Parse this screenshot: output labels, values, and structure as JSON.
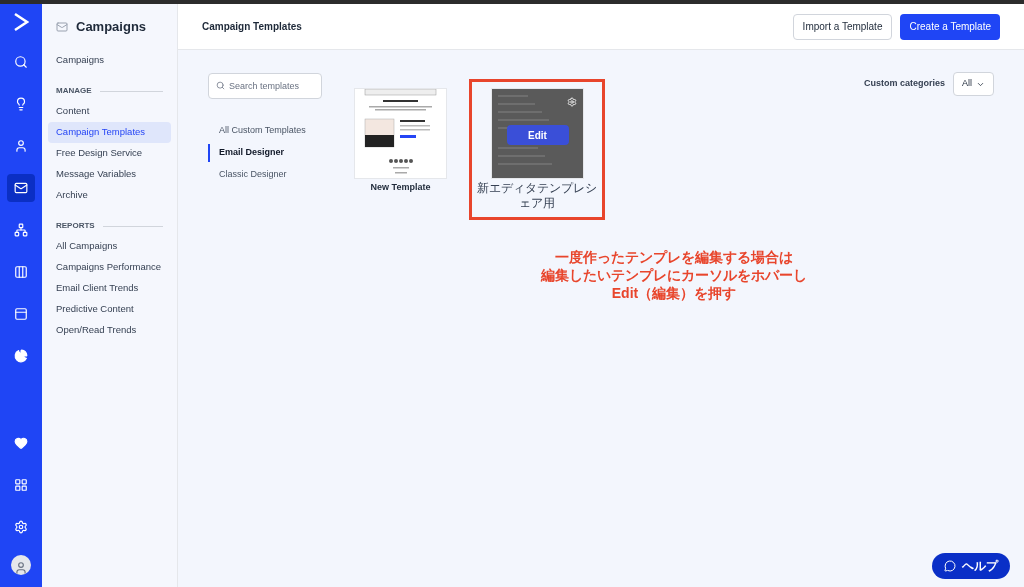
{
  "rail": {
    "items": [
      {
        "selected": false
      },
      {
        "selected": false
      },
      {
        "selected": false
      },
      {
        "selected": true
      },
      {
        "selected": false
      },
      {
        "selected": false
      },
      {
        "selected": false
      },
      {
        "selected": false
      }
    ]
  },
  "sidebar": {
    "title": "Campaigns",
    "sections": [
      {
        "items": [
          {
            "label": "Campaigns",
            "selected": false
          }
        ]
      },
      {
        "heading": "MANAGE",
        "items": [
          {
            "label": "Content",
            "selected": false
          },
          {
            "label": "Campaign Templates",
            "selected": true
          },
          {
            "label": "Free Design Service",
            "selected": false
          },
          {
            "label": "Message Variables",
            "selected": false
          },
          {
            "label": "Archive",
            "selected": false
          }
        ]
      },
      {
        "heading": "REPORTS",
        "items": [
          {
            "label": "All Campaigns",
            "selected": false
          },
          {
            "label": "Campaigns Performance",
            "selected": false
          },
          {
            "label": "Email Client Trends",
            "selected": false
          },
          {
            "label": "Predictive Content",
            "selected": false
          },
          {
            "label": "Open/Read Trends",
            "selected": false
          }
        ]
      }
    ]
  },
  "header": {
    "title": "Campaign Templates",
    "buttons": [
      {
        "label": "Import a Template",
        "kind": "secondary"
      },
      {
        "label": "Create a Template",
        "kind": "primary"
      }
    ]
  },
  "search": {
    "placeholder": "Search templates"
  },
  "categories": {
    "label": "Custom categories",
    "value": "All"
  },
  "filters": [
    {
      "label": "All Custom Templates",
      "selected": false
    },
    {
      "label": "Email Designer",
      "selected": true
    },
    {
      "label": "Classic Designer",
      "selected": false
    }
  ],
  "templates": [
    {
      "name": "New Template",
      "hovered": false
    },
    {
      "name": "新エディタテンプレシェア用",
      "hovered": true,
      "action": "Edit"
    }
  ],
  "annotation": {
    "lines": [
      "一度作ったテンプレを編集する場合は",
      "編集したいテンプレにカーソルをホバーし",
      "Edit（編集）を押す"
    ]
  },
  "help": {
    "label": "ヘルプ"
  }
}
